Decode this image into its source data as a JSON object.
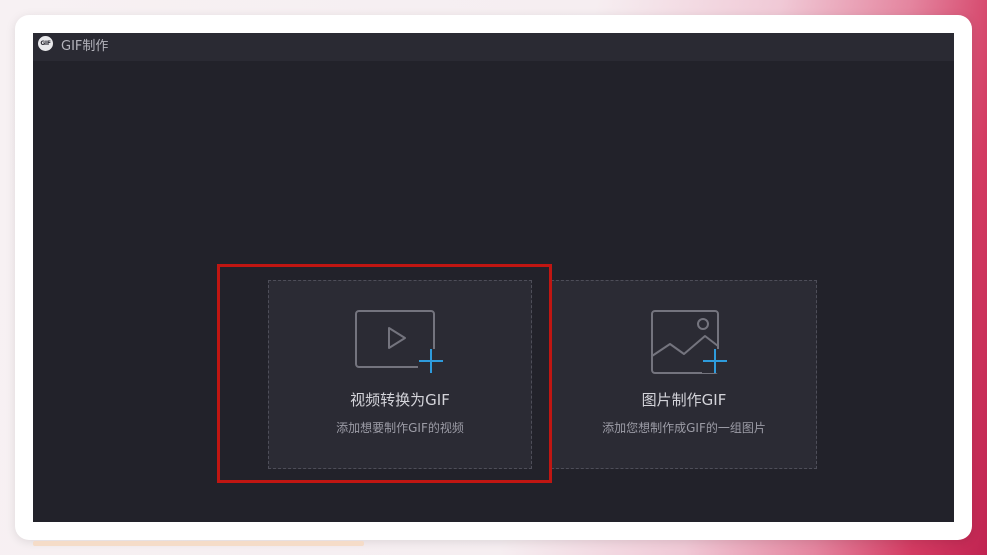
{
  "window": {
    "logo_text": "GIF",
    "title": "GIF制作"
  },
  "cards": [
    {
      "title": "视频转换为GIF",
      "subtitle": "添加想要制作GIF的视频",
      "icon": "video-add-icon"
    },
    {
      "title": "图片制作GIF",
      "subtitle": "添加您想制作成GIF的一组图片",
      "icon": "image-add-icon"
    }
  ],
  "colors": {
    "app_background": "#22222a",
    "titlebar_background": "#2a2a33",
    "card_background": "#2b2b34",
    "accent_plus": "#2e9bdc",
    "highlight_border": "#c01612"
  }
}
